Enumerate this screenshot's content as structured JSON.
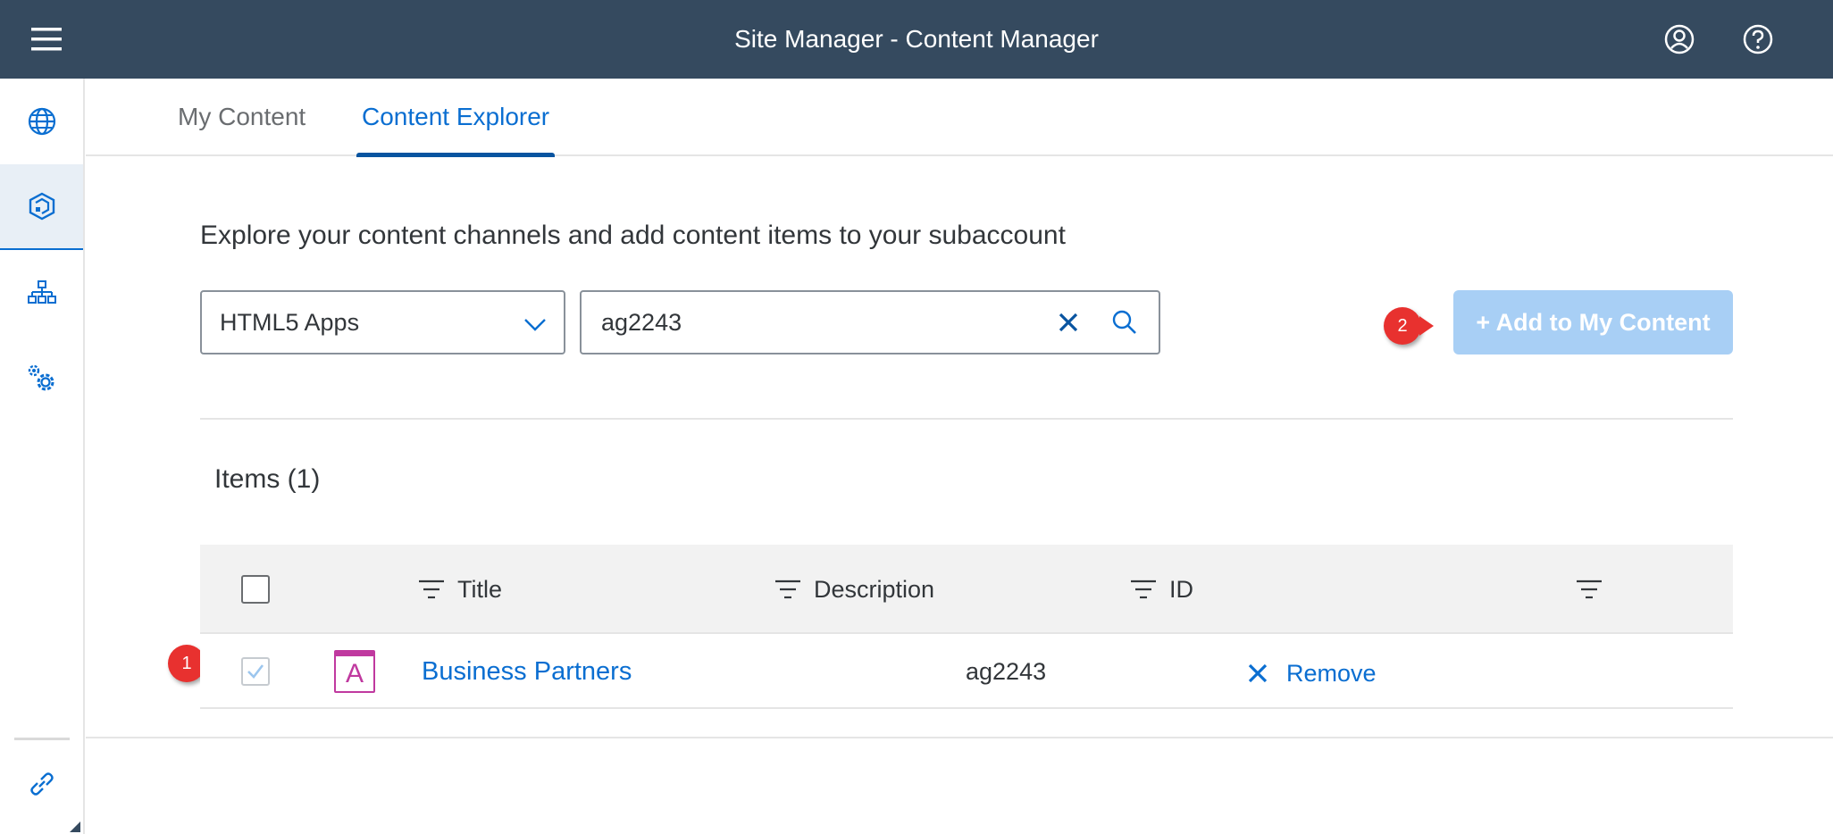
{
  "shell": {
    "title": "Site Manager - Content Manager",
    "menu_icon": "hamburger-menu-icon",
    "profile_icon": "user-profile-icon",
    "help_icon": "help-icon",
    "background": "#354a5f"
  },
  "sidenav": {
    "items": [
      {
        "icon": "globe-icon",
        "active": false
      },
      {
        "icon": "content-package-icon",
        "active": true
      },
      {
        "icon": "hierarchy-icon",
        "active": false
      },
      {
        "icon": "settings-gears-icon",
        "active": false
      }
    ],
    "footer_icon": "link-icon"
  },
  "tabs": [
    {
      "label": "My Content",
      "active": false
    },
    {
      "label": "Content Explorer",
      "active": true
    }
  ],
  "explorer": {
    "subtitle": "Explore your content channels and add content items to your subaccount",
    "channel_select": {
      "selected": "HTML5 Apps"
    },
    "search": {
      "value": "ag2243",
      "placeholder": ""
    },
    "add_button_label": "+ Add to My Content",
    "items_title": "Items  (1)",
    "columns": [
      "Title",
      "Description",
      "ID",
      ""
    ],
    "rows": [
      {
        "checked": true,
        "icon_letter": "A",
        "title": "Business Partners",
        "description": "",
        "id": "ag2243",
        "action_label": "Remove"
      }
    ]
  },
  "callouts": [
    "1",
    "2"
  ],
  "colors": {
    "accent": "#0a6ed1",
    "callout": "#e8312f",
    "add_button_disabled": "#a8cff5",
    "app_icon": "#c0399f"
  }
}
